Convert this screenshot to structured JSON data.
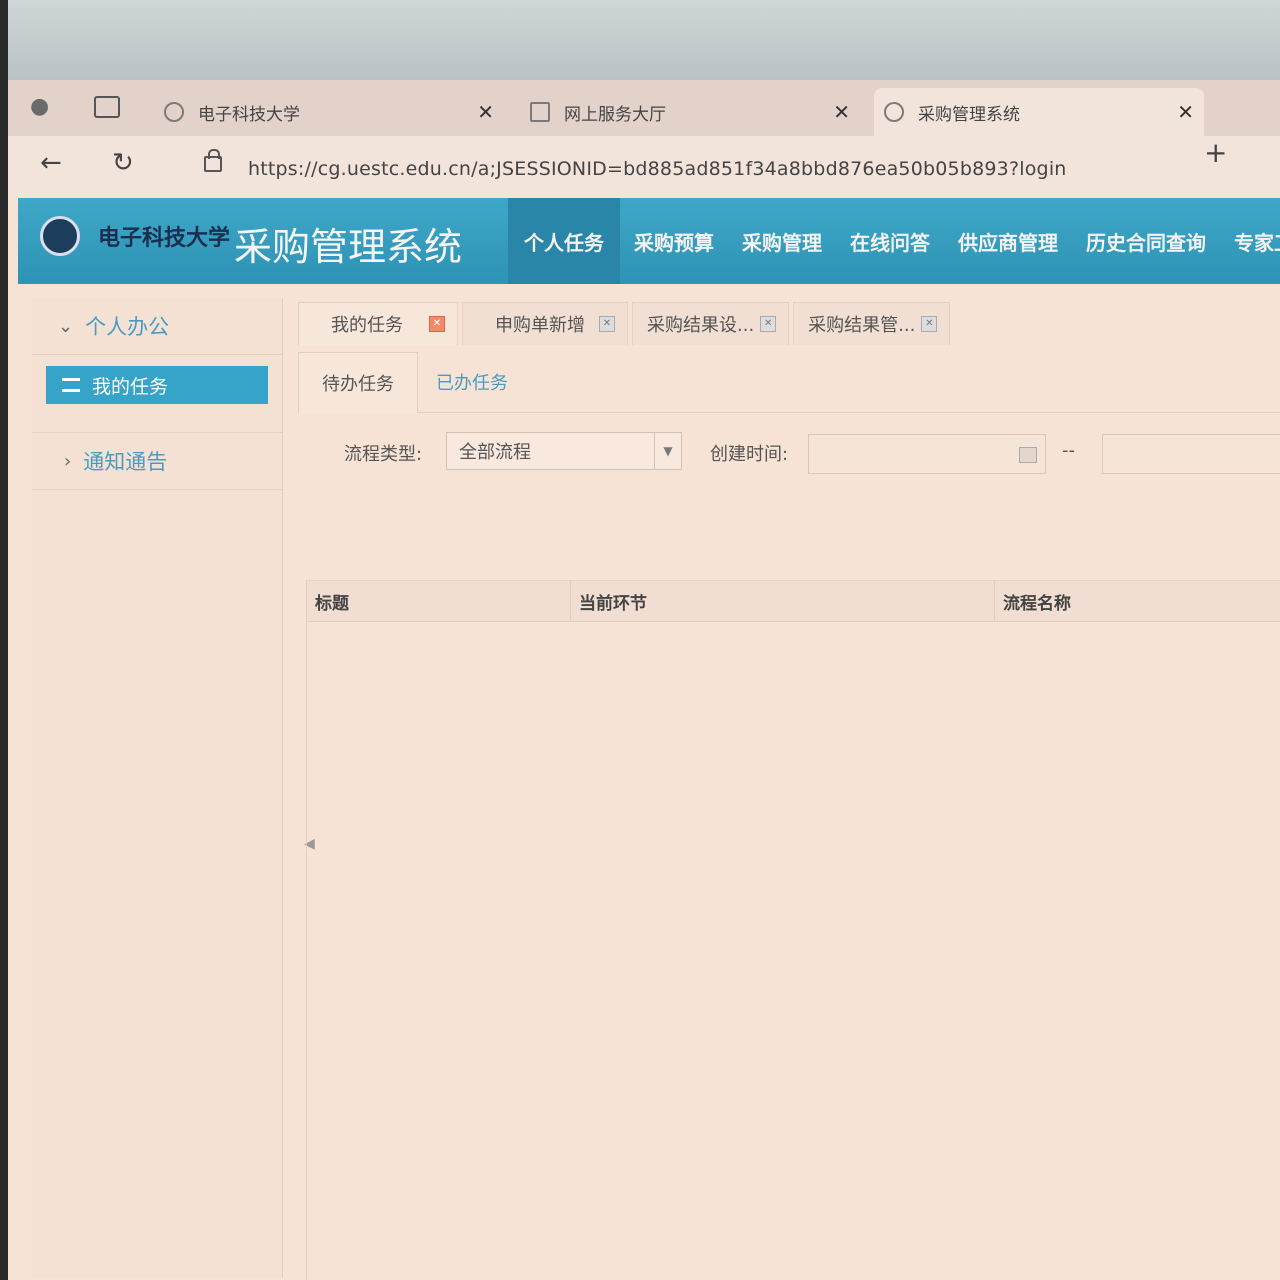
{
  "browser": {
    "tabs": [
      {
        "title": "电子科技大学"
      },
      {
        "title": "网上服务大厅"
      },
      {
        "title": "采购管理系统"
      }
    ],
    "new_tab_label": "+",
    "url": "https://cg.uestc.edu.cn/a;JSESSIONID=bd885ad851f34a8bbd876ea50b05b893?login"
  },
  "app": {
    "logo_text": "电子科技大学",
    "title": "采购管理系统",
    "nav": [
      "个人任务",
      "采购预算",
      "采购管理",
      "在线问答",
      "供应商管理",
      "历史合同查询",
      "专家工作"
    ],
    "active_nav_index": 0
  },
  "sidebar": {
    "section": "个人办公",
    "active_item": "我的任务",
    "notice": "通知通告"
  },
  "page_tabs": [
    "我的任务",
    "申购单新增",
    "采购结果设...",
    "采购结果管..."
  ],
  "sub_tabs": {
    "active": "待办任务",
    "other": "已办任务"
  },
  "filter": {
    "process_type_label": "流程类型:",
    "process_type_value": "全部流程",
    "create_time_label": "创建时间:",
    "range_sep": "--"
  },
  "grid": {
    "columns": [
      "标题",
      "当前环节",
      "流程名称"
    ]
  },
  "colors": {
    "header_bg": "#2e93b6",
    "accent": "#36a4c9",
    "link": "#4b9bc0"
  }
}
